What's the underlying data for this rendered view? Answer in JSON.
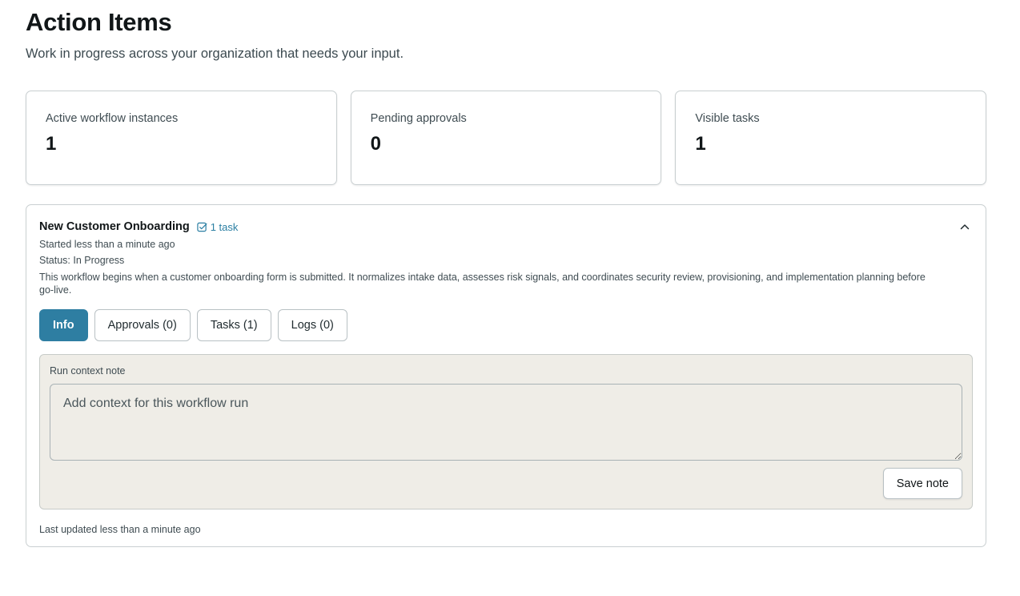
{
  "header": {
    "title": "Action Items",
    "subtitle": "Work in progress across your organization that needs your input."
  },
  "stats": [
    {
      "label": "Active workflow instances",
      "value": "1"
    },
    {
      "label": "Pending approvals",
      "value": "0"
    },
    {
      "label": "Visible tasks",
      "value": "1"
    }
  ],
  "workflow": {
    "title": "New Customer Onboarding",
    "task_badge": "1 task",
    "task_badge_icon": "checkbox-icon",
    "collapse_icon": "chevron-up-icon",
    "started": "Started less than a minute ago",
    "status": "Status: In Progress",
    "description": "This workflow begins when a customer onboarding form is submitted. It normalizes intake data, assesses risk signals, and coordinates security review, provisioning, and implementation planning before go-live.",
    "tabs": [
      {
        "label": "Info",
        "active": true
      },
      {
        "label": "Approvals (0)",
        "active": false
      },
      {
        "label": "Tasks (1)",
        "active": false
      },
      {
        "label": "Logs (0)",
        "active": false
      }
    ],
    "note": {
      "label": "Run context note",
      "value": "",
      "placeholder": "Add context for this workflow run",
      "save_label": "Save note"
    },
    "footer": "Last updated less than a minute ago"
  },
  "colors": {
    "accent": "#2e7ea2",
    "link": "#2b7fa3",
    "panel_bg": "#efede7"
  }
}
